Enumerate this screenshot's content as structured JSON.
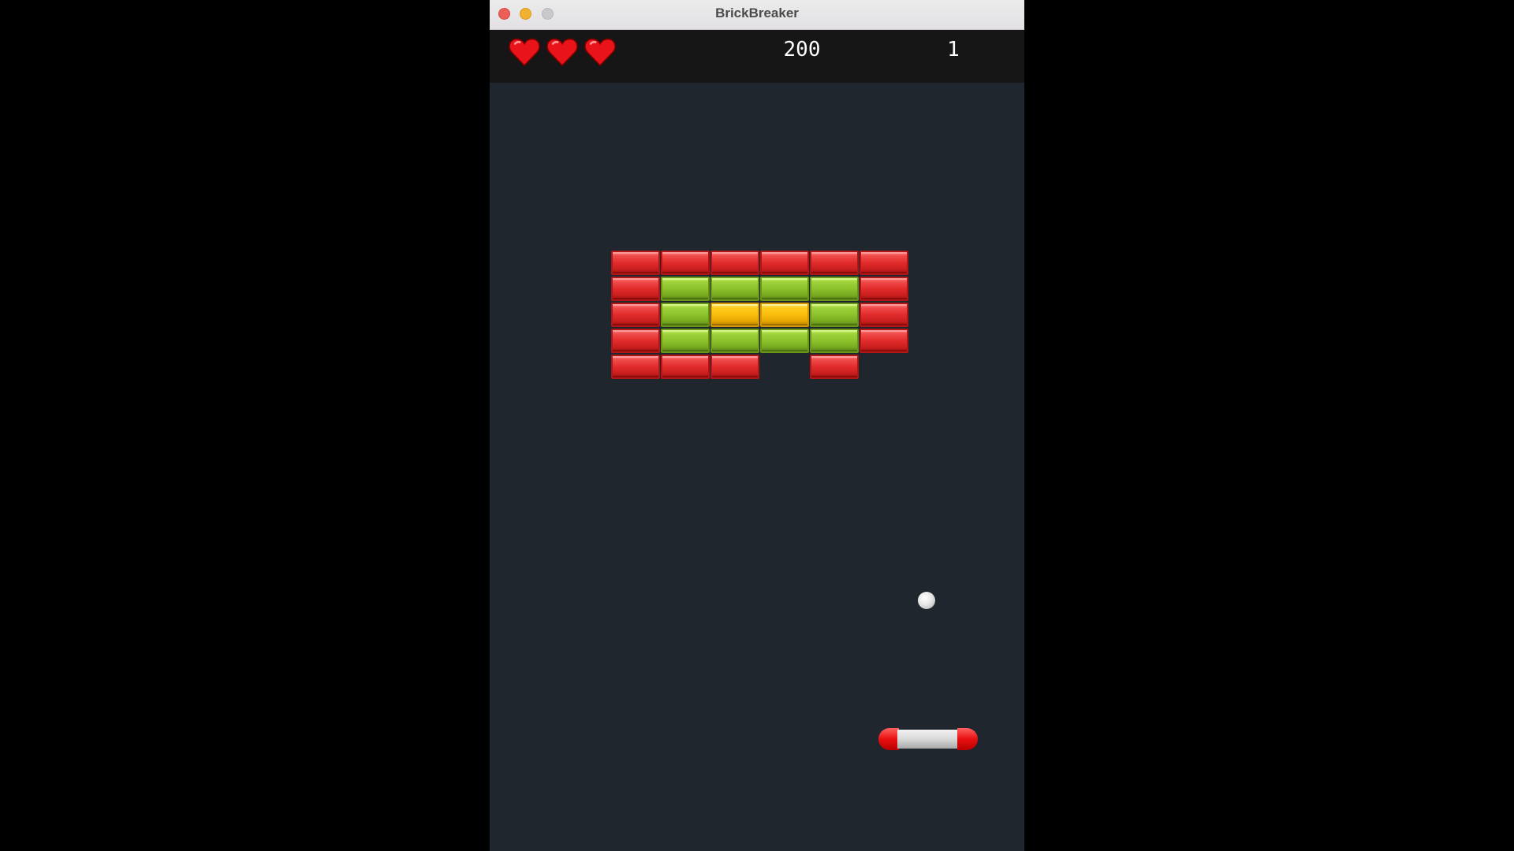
{
  "window": {
    "title": "BrickBreaker"
  },
  "hud": {
    "lives": 3,
    "score": "200",
    "level": "1"
  },
  "colors": {
    "red_brick": "#e22b2b",
    "green_brick": "#8cc22c",
    "yellow_brick": "#f9bd0c",
    "background": "#20262d",
    "hud_background": "#161616",
    "heart": "#e8141a"
  },
  "bricks": {
    "columns": 6,
    "rows": [
      [
        "red",
        "red",
        "red",
        "red",
        "red",
        "red"
      ],
      [
        "red",
        "green",
        "green",
        "green",
        "green",
        "red"
      ],
      [
        "red",
        "green",
        "yellow",
        "yellow",
        "green",
        "red"
      ],
      [
        "red",
        "green",
        "green",
        "green",
        "green",
        "red"
      ],
      [
        "red",
        "red",
        "red",
        null,
        "red",
        null
      ]
    ]
  }
}
